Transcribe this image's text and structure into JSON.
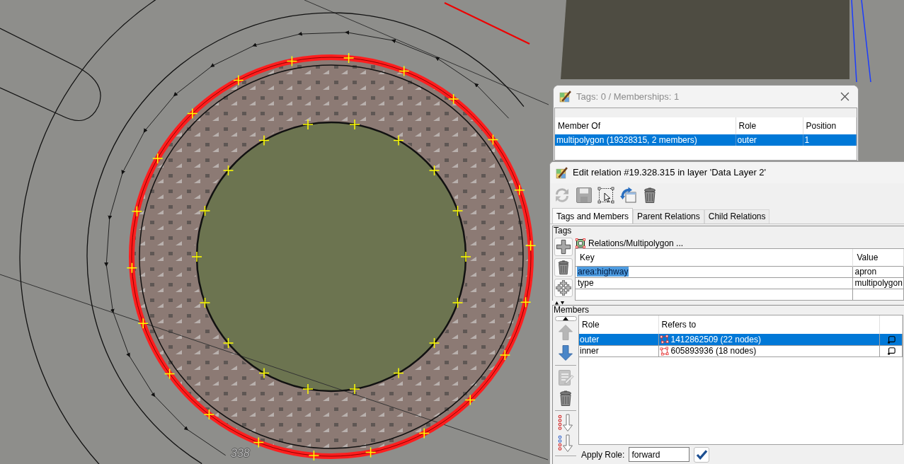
{
  "map": {
    "house_number": "338"
  },
  "tags_dialog": {
    "title": "Tags: 0 / Memberships: 1",
    "active": false,
    "columns": [
      "Member Of",
      "Role",
      "Position"
    ],
    "rows": [
      {
        "cells": [
          "multipolygon (19328315, 2 members)",
          "outer",
          "1"
        ],
        "selected": true
      }
    ]
  },
  "relation_editor": {
    "title": "Edit relation #19.328.315 in layer 'Data Layer 2'",
    "active": true,
    "toolbar": [
      {
        "kind": "refresh",
        "disabled": true
      },
      {
        "kind": "save",
        "disabled": true
      },
      {
        "kind": "select",
        "disabled": false
      },
      {
        "kind": "duplicate",
        "disabled": false
      },
      {
        "kind": "delete",
        "disabled": false
      }
    ],
    "tabs": [
      {
        "label": "Tags and Members",
        "selected": true
      },
      {
        "label": "Parent Relations",
        "selected": false
      },
      {
        "label": "Child Relations",
        "selected": false
      }
    ],
    "tags": {
      "label": "Tags",
      "buttons": [
        {
          "kind": "add",
          "disabled": false
        },
        {
          "kind": "delete",
          "disabled": false
        },
        {
          "kind": "add_multiple",
          "disabled": false
        }
      ],
      "preset": "Relations/Multipolygon ...",
      "columns": [
        "Key",
        "Value"
      ],
      "rows": [
        {
          "key": "area:highway",
          "value": "apron",
          "selected": true
        },
        {
          "key": "type",
          "value": "multipolygon",
          "selected": false
        }
      ]
    },
    "members": {
      "label": "Members",
      "buttons": [
        {
          "kind": "scroll_up",
          "disabled": false
        },
        {
          "kind": "move_up",
          "disabled": true
        },
        {
          "kind": "move_down",
          "disabled": false
        },
        {
          "kind": "edit",
          "disabled": true
        },
        {
          "kind": "delete",
          "disabled": false
        },
        {
          "kind": "sort",
          "disabled": false
        },
        {
          "kind": "reverse",
          "disabled": false
        }
      ],
      "columns": [
        "Role",
        "Refers to"
      ],
      "rows": [
        {
          "role": "outer",
          "refers_to": "1412862509 (22 nodes)",
          "selected": true
        },
        {
          "role": "inner",
          "refers_to": "605893936 (18 nodes)",
          "selected": false
        }
      ],
      "apply_role": {
        "label": "Apply Role:",
        "value": "forward"
      }
    }
  }
}
